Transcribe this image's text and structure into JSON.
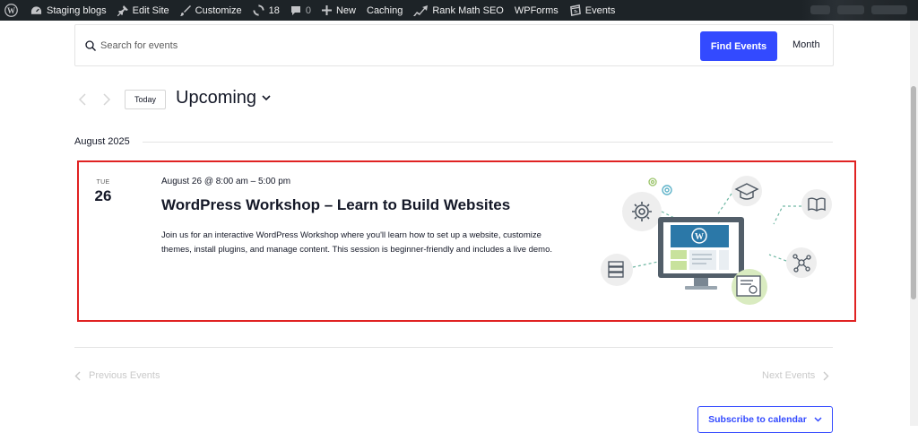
{
  "admin_bar": {
    "site_name": "Staging blogs",
    "edit_site": "Edit Site",
    "customize": "Customize",
    "updates_count": "18",
    "comments_count": "0",
    "new": "New",
    "caching": "Caching",
    "rank_math": "Rank Math SEO",
    "wpforms": "WPForms",
    "events": "Events"
  },
  "search": {
    "placeholder": "Search for events",
    "button_label": "Find Events",
    "view_label": "Month"
  },
  "date_nav": {
    "today_label": "Today",
    "range_label": "Upcoming"
  },
  "month_separator": "August 2025",
  "event": {
    "day_of_week": "TUE",
    "day": "26",
    "time": "August 26 @ 8:00 am – 5:00 pm",
    "title": "WordPress Workshop – Learn to Build Websites",
    "description": "Join us for an interactive WordPress Workshop where you'll learn how to set up a website, customize themes, install plugins, and manage content. This session is beginner-friendly and includes a live demo."
  },
  "pagination": {
    "previous": "Previous Events",
    "next": "Next Events"
  },
  "subscribe_label": "Subscribe to calendar",
  "colors": {
    "accent": "#334aff",
    "admin_bar_bg": "#1d2327",
    "highlight_border": "#e02222",
    "disabled_text": "#c9c9c9"
  }
}
